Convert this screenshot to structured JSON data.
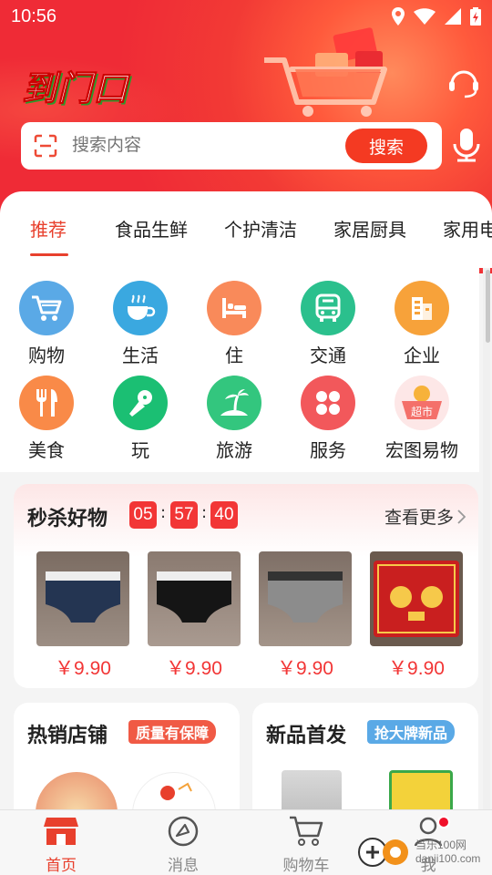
{
  "status_bar": {
    "time": "10:56"
  },
  "header": {
    "logo_text": "到门口"
  },
  "search": {
    "placeholder": "搜索内容",
    "button": "搜索"
  },
  "tabs": [
    "推荐",
    "食品生鲜",
    "个护清洁",
    "家居厨具",
    "家用电"
  ],
  "categories": [
    {
      "label": "购物",
      "icon": "cart-icon",
      "color": "#5aa9e6"
    },
    {
      "label": "生活",
      "icon": "cup-icon",
      "color": "#3aa8e0"
    },
    {
      "label": "住",
      "icon": "bed-icon",
      "color": "#f98a5a"
    },
    {
      "label": "交通",
      "icon": "bus-icon",
      "color": "#2bc08d"
    },
    {
      "label": "企业",
      "icon": "building-icon",
      "color": "#f7a23a"
    },
    {
      "label": "美食",
      "icon": "utensils-icon",
      "color": "#f98a48"
    },
    {
      "label": "玩",
      "icon": "microphone-icon",
      "color": "#1bbf73"
    },
    {
      "label": "旅游",
      "icon": "palm-island-icon",
      "color": "#33c67e"
    },
    {
      "label": "服务",
      "icon": "clover-grid-icon",
      "color": "#f2585b"
    },
    {
      "label": "宏图易物",
      "icon": "supermarket-basket-icon",
      "badge": "超市",
      "color": "#f4706a"
    }
  ],
  "flash_sale": {
    "title": "秒杀好物",
    "countdown": [
      "05",
      "57",
      "40"
    ],
    "more": "查看更多",
    "products": [
      {
        "price": "￥9.90",
        "kind": "navy-briefs"
      },
      {
        "price": "￥9.90",
        "kind": "black-briefs"
      },
      {
        "price": "￥9.90",
        "kind": "grey-briefs"
      },
      {
        "price": "￥9.90",
        "kind": "red-door-mat"
      }
    ]
  },
  "sections": {
    "hot_stores": {
      "title": "热销店铺",
      "badge": "质量有保障"
    },
    "new_products": {
      "title": "新品首发",
      "badge": "抢大牌新品"
    }
  },
  "nav": {
    "items": [
      "首页",
      "消息",
      "购物车",
      "我"
    ]
  },
  "watermark": {
    "line1": "当乐100网",
    "line2": "danji100.com"
  },
  "colors": {
    "brand_red": "#e8402d",
    "accent_orange": "#f4a23a",
    "accent_blue": "#5aa9e6"
  }
}
